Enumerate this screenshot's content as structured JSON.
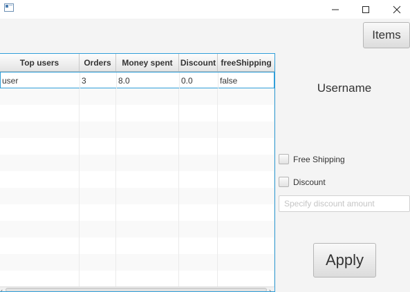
{
  "window": {
    "title": ""
  },
  "toolbar": {
    "items_label": "Items"
  },
  "table": {
    "columns": [
      "Top users",
      "Orders",
      "Money spent",
      "Discount",
      "freeShipping"
    ],
    "rows": [
      [
        "user",
        "3",
        "8.0",
        "0.0",
        "false"
      ]
    ]
  },
  "panel": {
    "username_label": "Username",
    "free_shipping_label": "Free Shipping",
    "discount_label": "Discount",
    "discount_placeholder": "Specify discount amount",
    "apply_label": "Apply"
  }
}
